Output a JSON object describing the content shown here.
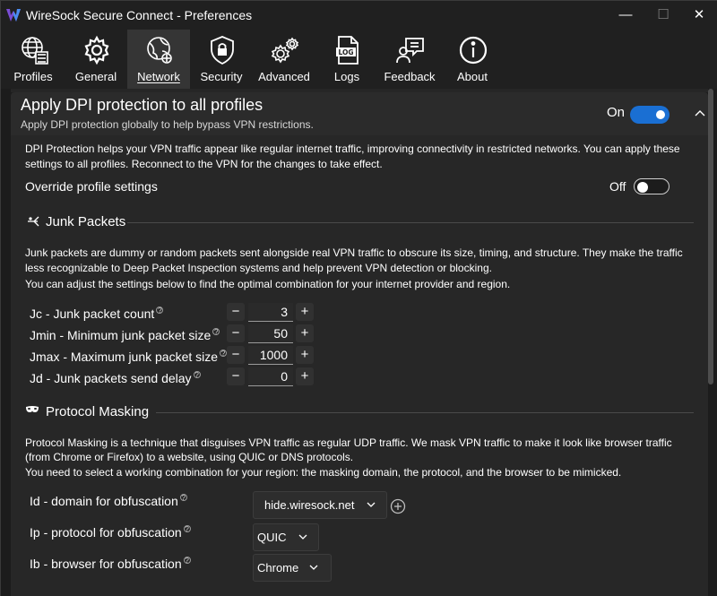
{
  "window": {
    "title": "WireSock Secure Connect - Preferences",
    "minimize_glyph": "—",
    "maximize_glyph": "☐",
    "close_glyph": "✕"
  },
  "toolbar": {
    "items": [
      {
        "label": "Profiles",
        "icon": "profiles-globe-icon"
      },
      {
        "label": "General",
        "icon": "gear-icon"
      },
      {
        "label": "Network",
        "icon": "network-globe-icon",
        "active": true
      },
      {
        "label": "Security",
        "icon": "shield-lock-icon"
      },
      {
        "label": "Advanced",
        "icon": "gears-icon"
      },
      {
        "label": "Logs",
        "icon": "log-file-icon"
      },
      {
        "label": "Feedback",
        "icon": "feedback-icon"
      },
      {
        "label": "About",
        "icon": "info-icon"
      }
    ]
  },
  "dpi": {
    "title": "Apply DPI protection to all profiles",
    "subtitle": "Apply DPI protection globally to help bypass VPN restrictions.",
    "toggle_label": "On",
    "toggle_state": true,
    "description_line1": "DPI Protection helps your VPN traffic appear like regular internet traffic, improving connectivity in restricted networks. You can apply these",
    "description_line2": "settings to all profiles. Reconnect to the VPN for the changes to take effect.",
    "override_label": "Override profile settings",
    "override_toggle_label": "Off",
    "override_state": false
  },
  "junk": {
    "heading": "Junk Packets",
    "desc_line1": "Junk packets are dummy or random packets sent alongside real VPN traffic to obscure its size, timing, and structure. They make the traffic",
    "desc_line2": "less recognizable to Deep Packet Inspection systems and help prevent VPN detection or blocking.",
    "desc_line3": "You can adjust the settings below to find the optimal combination for your internet provider and region.",
    "fields": [
      {
        "label": "Jc - Junk packet count",
        "value": "3"
      },
      {
        "label": "Jmin - Minimum junk packet size",
        "value": "50"
      },
      {
        "label": "Jmax - Maximum junk packet size",
        "value": "1000"
      },
      {
        "label": "Jd - Junk packets send delay",
        "value": "0"
      }
    ],
    "minus": "−",
    "plus": "+"
  },
  "masking": {
    "heading": "Protocol Masking",
    "desc_line1": "Protocol Masking is a technique that disguises VPN traffic as regular UDP traffic. We mask VPN traffic to make it look like browser traffic",
    "desc_line2": "(from Chrome or Firefox) to a website, using QUIC or DNS protocols.",
    "desc_line3": "You need to select a working combination for your region: the masking domain, the protocol, and the browser to be mimicked.",
    "fields": [
      {
        "label": "Id - domain for obfuscation",
        "value": "hide.wiresock.net"
      },
      {
        "label": "Ip - protocol for obfuscation",
        "value": "QUIC"
      },
      {
        "label": "Ib - browser for obfuscation",
        "value": "Chrome"
      }
    ]
  },
  "help_glyph": "?",
  "colors": {
    "accent": "#1a6fd3",
    "background": "#1c1c1c",
    "panel": "#272727"
  }
}
